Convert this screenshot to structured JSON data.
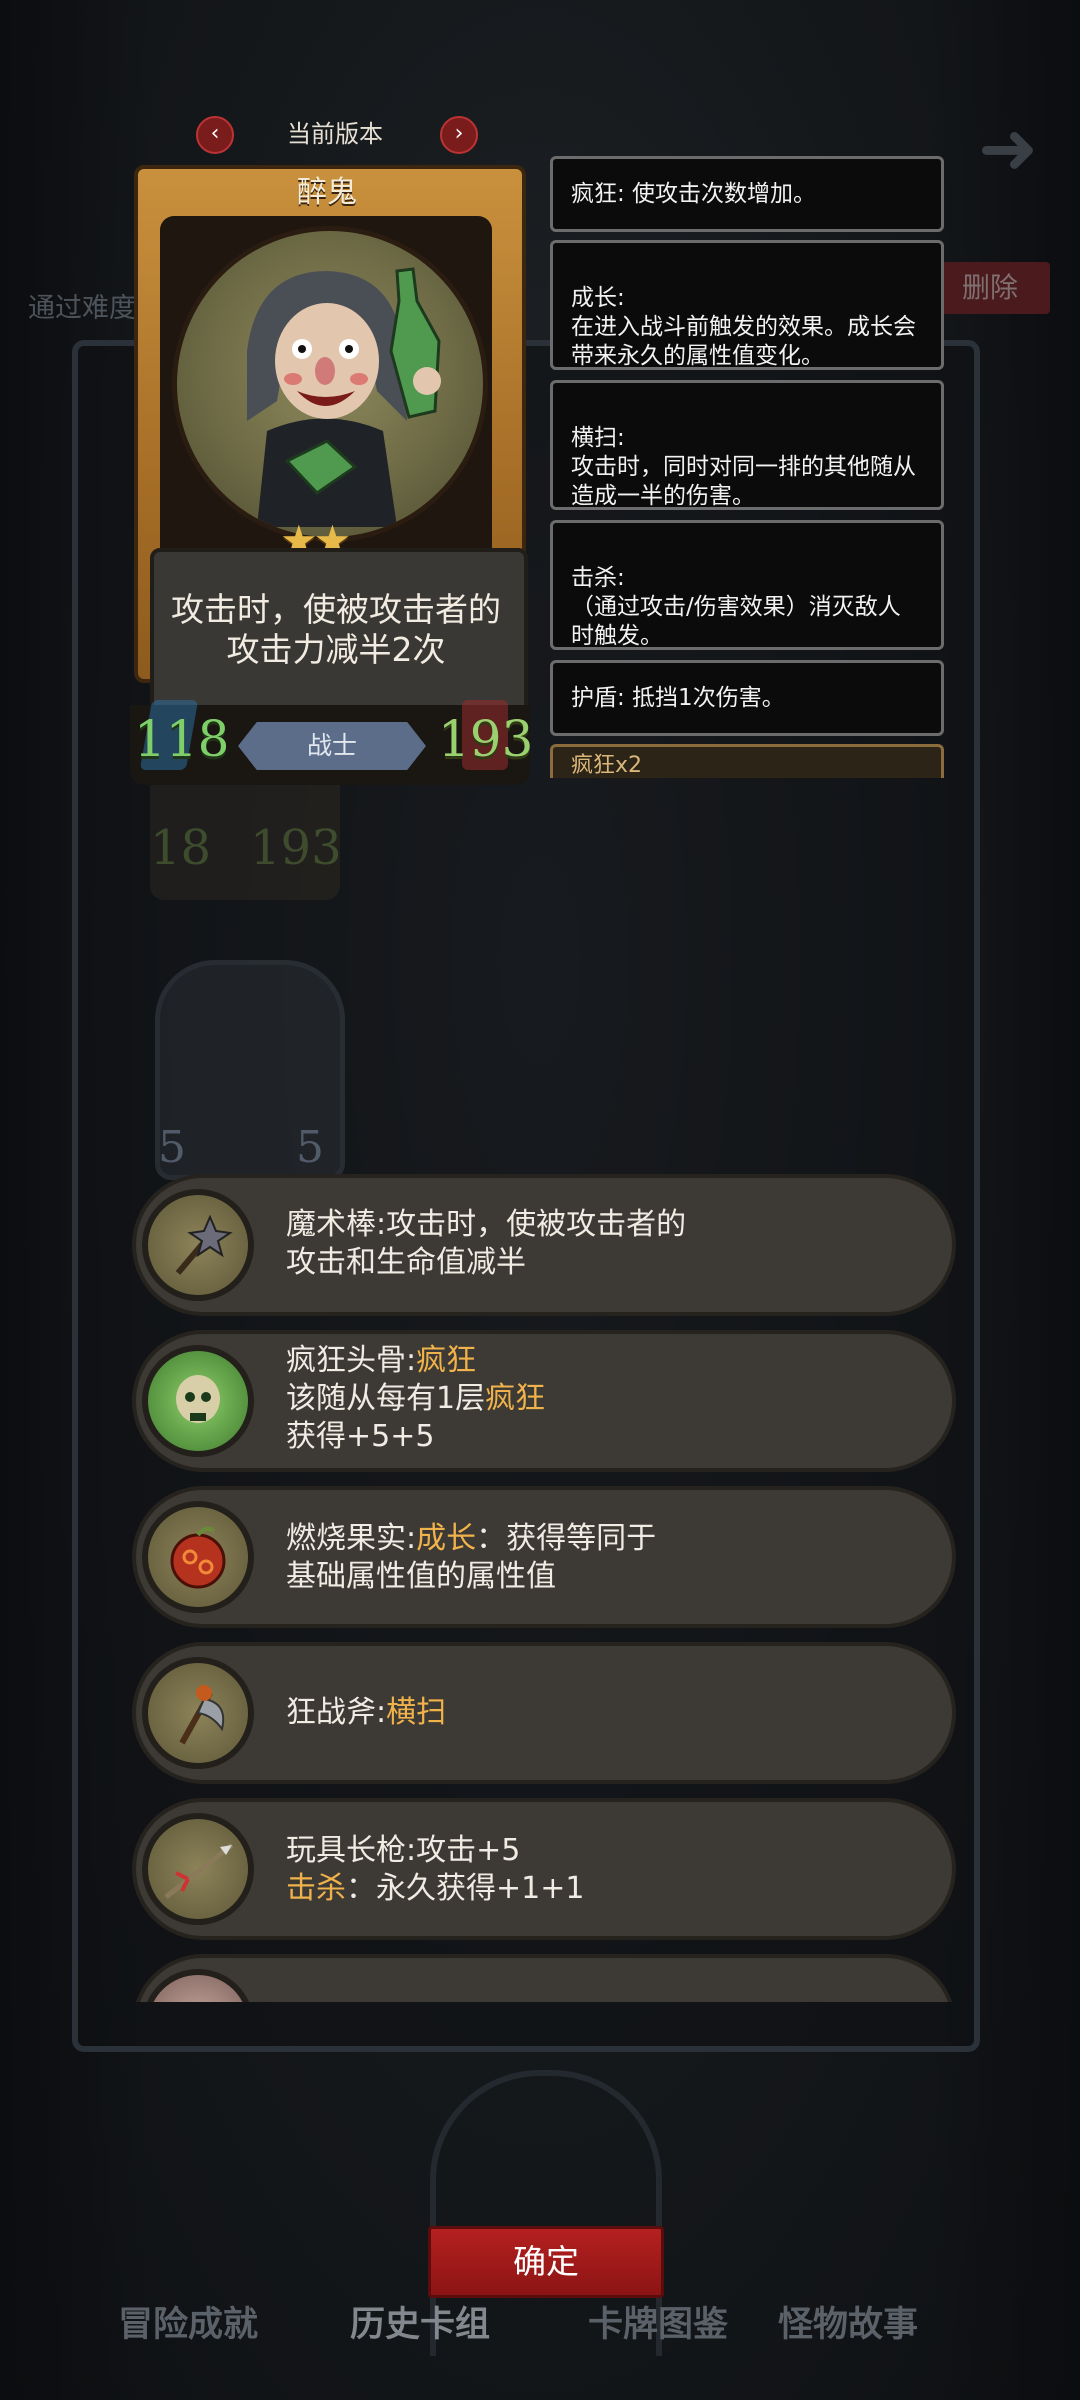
{
  "header": {
    "version_label": "当前版本",
    "prev_icon": "chevron-left-icon",
    "next_icon": "chevron-right-icon",
    "back_icon": "back-arrow-icon"
  },
  "background": {
    "left_text": "通过难度",
    "delete_label": "删除",
    "faded_card1": {
      "atk": "18",
      "hp": "193"
    },
    "faded_card2": {
      "atk": "5",
      "hp": "5"
    }
  },
  "card": {
    "name": "醉鬼",
    "stars": "★★",
    "description": "攻击时，使被攻击者的攻击力减半2次",
    "attack": "118",
    "health": "193",
    "class": "战士"
  },
  "tooltips": [
    {
      "text": "疯狂: 使攻击次数增加。"
    },
    {
      "text": "成长:\n在进入战斗前触发的效果。成长会带来永久的属性值变化。"
    },
    {
      "text": "横扫:\n攻击时，同时对同一排的其他随从造成一半的伤害。"
    },
    {
      "text": "击杀:\n（通过攻击/伤害效果）消灭敌人时触发。"
    },
    {
      "text": "护盾: 抵挡1次伤害。"
    },
    {
      "text": "疯狂x2"
    }
  ],
  "equipment": [
    {
      "icon": "magic-wand-icon",
      "line1": "魔术棒:攻击时，使被攻击者的",
      "line2": "攻击和生命值减半"
    },
    {
      "icon": "crazy-skull-icon",
      "line1_a": "疯狂头骨:",
      "line1_hl": "疯狂",
      "line2_a": "该随从每有1层",
      "line2_hl": "疯狂",
      "line3": "获得+5+5"
    },
    {
      "icon": "burning-fruit-icon",
      "line1_a": "燃烧果实:",
      "line1_hl": "成长",
      "line1_b": "：获得等同于",
      "line2": "基础属性值的属性值"
    },
    {
      "icon": "berserker-axe-icon",
      "line1_a": "狂战斧:",
      "line1_hl": "横扫"
    },
    {
      "icon": "toy-spear-icon",
      "line1": "玩具长枪:攻击+5",
      "line2_hl": "击杀",
      "line2_b": "：永久获得+1+1"
    },
    {
      "icon": "pig-item-icon"
    }
  ],
  "confirm_label": "确定",
  "bottom_tabs": [
    "冒险成就",
    "历史卡组",
    "卡牌图鉴",
    "怪物故事"
  ]
}
